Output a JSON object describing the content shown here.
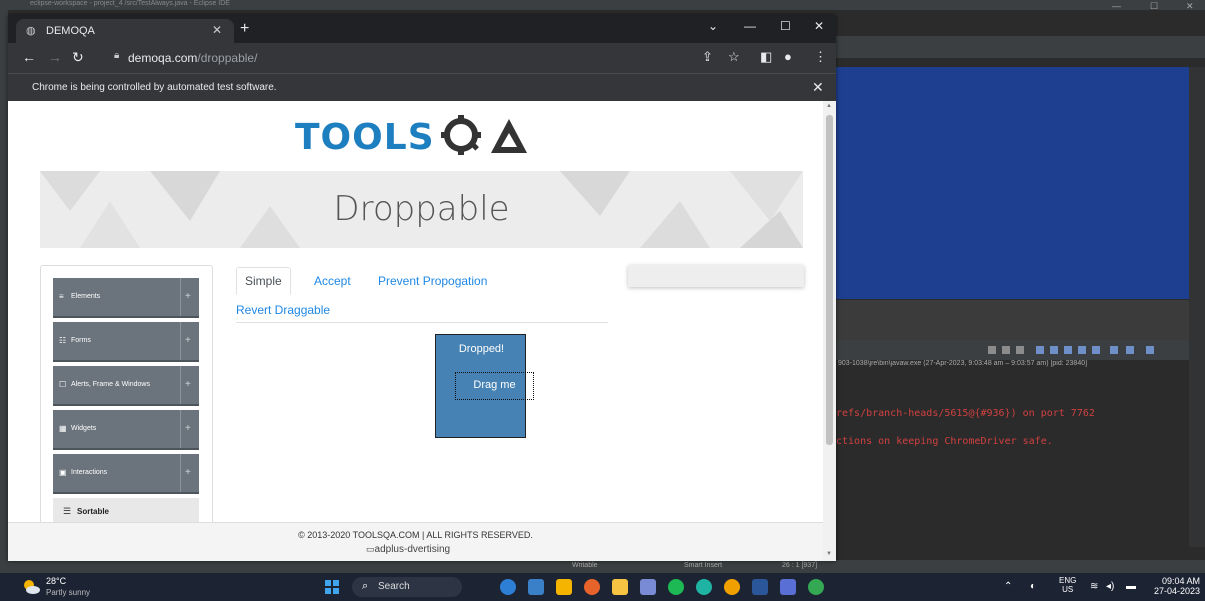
{
  "ide": {
    "title": "eclipse-workspace - project_4 /src/TestAlways.java - Eclipse IDE",
    "console_path": "903-1038\\jre\\bin\\javaw.exe (27-Apr-2023, 9:03:48 am – 9:03:57 am) [pid: 23840]",
    "console_lines": [
      "refs/branch-heads/5615@{#936}) on port 7762",
      "ctions on keeping ChromeDriver safe."
    ],
    "status": {
      "writable": "Writable",
      "insert": "Smart Insert",
      "position": "26 : 1 [937]"
    }
  },
  "chrome": {
    "tab_title": "DEMOQA",
    "url_host": "demoqa.com",
    "url_path": "/droppable/",
    "infobar_text": "Chrome is being controlled by automated test software."
  },
  "page": {
    "logo_text": "TOOLSQA",
    "banner_title": "Droppable",
    "sidebar": [
      {
        "icon": "≡",
        "label": "Elements",
        "toggle": "+"
      },
      {
        "icon": "☷",
        "label": "Forms",
        "toggle": "+"
      },
      {
        "icon": "☐",
        "label": "Alerts, Frame & Windows",
        "toggle": "+"
      },
      {
        "icon": "▦",
        "label": "Widgets",
        "toggle": "+"
      },
      {
        "icon": "▣",
        "label": "Interactions",
        "toggle": "+"
      }
    ],
    "sidebar_sub": {
      "label": "Sortable"
    },
    "tabs": [
      "Simple",
      "Accept",
      "Prevent Propogation",
      "Revert Draggable"
    ],
    "drop_label": "Dropped!",
    "drag_label": "Drag me",
    "footer_text": "© 2013-2020 TOOLSQA.COM | ALL RIGHTS RESERVED.",
    "ad_alt": "adplus-dvertising"
  },
  "taskbar": {
    "temp": "28°C",
    "weather": "Partly sunny",
    "search_label": "Search",
    "lang": "ENG",
    "region": "US",
    "time": "09:04 AM",
    "date": "27-04-2023"
  },
  "colors": {
    "drop_box": "#4682b4",
    "sidebar_group": "#6b747c",
    "tab_link": "#1e88e5",
    "ide_blue": "#1e3f8f",
    "console_text": "#d24040"
  }
}
